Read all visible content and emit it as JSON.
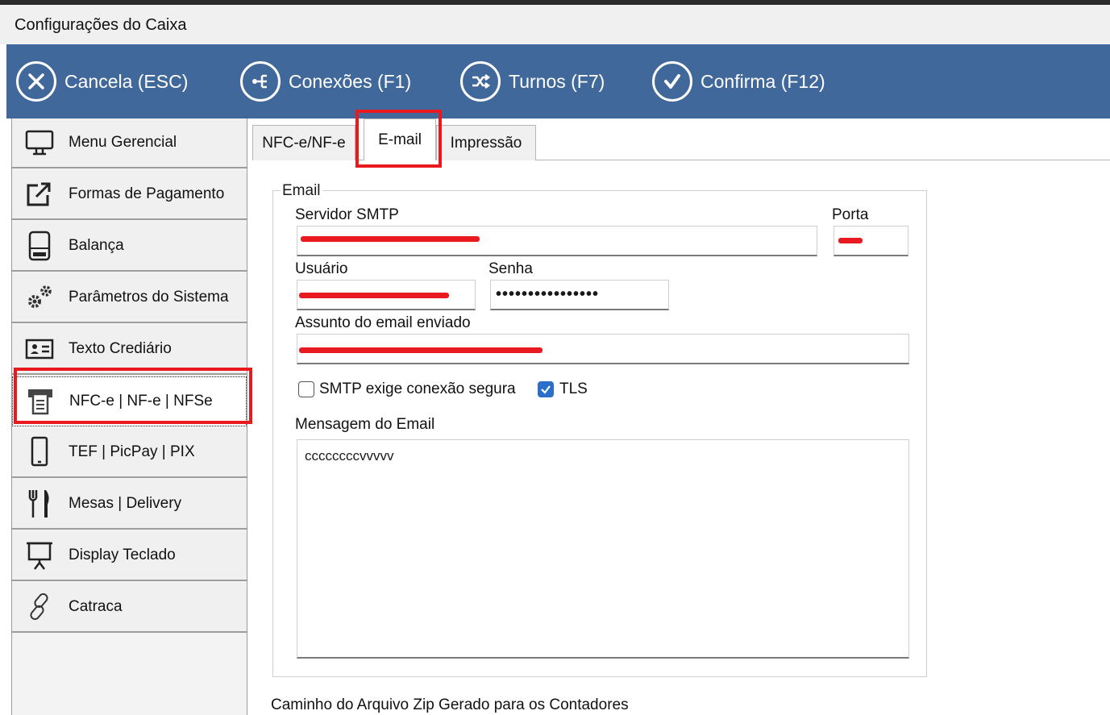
{
  "window": {
    "title": "Configurações do Caixa"
  },
  "toolbar": {
    "cancel_label": "Cancela (ESC)",
    "connections_label": "Conexões (F1)",
    "shifts_label": "Turnos (F7)",
    "confirm_label": "Confirma (F12)"
  },
  "sidebar": {
    "items": [
      {
        "label": "Menu Gerencial",
        "icon": "monitor-icon"
      },
      {
        "label": "Formas de Pagamento",
        "icon": "external-link-icon"
      },
      {
        "label": "Balança",
        "icon": "scale-icon"
      },
      {
        "label": "Parâmetros do Sistema",
        "icon": "gears-icon"
      },
      {
        "label": "Texto Crediário",
        "icon": "id-card-icon"
      },
      {
        "label": "NFC-e | NF-e | NFSe",
        "icon": "receipt-printer-icon",
        "selected": true
      },
      {
        "label": "TEF | PicPay | PIX",
        "icon": "smartphone-icon"
      },
      {
        "label": "Mesas | Delivery",
        "icon": "utensils-icon"
      },
      {
        "label": "Display Teclado",
        "icon": "presentation-board-icon"
      },
      {
        "label": "Catraca",
        "icon": "link-icon"
      }
    ]
  },
  "tabs": [
    {
      "label": "NFC-e/NF-e"
    },
    {
      "label": "E-mail",
      "active": true
    },
    {
      "label": "Impressão"
    }
  ],
  "email": {
    "group_title": "Email",
    "smtp_server_label": "Servidor SMTP",
    "port_label": "Porta",
    "user_label": "Usuário",
    "password_label": "Senha",
    "password_value": "••••••••••••••••",
    "subject_label": "Assunto do email enviado",
    "secure_smtp_label": "SMTP exige conexão segura",
    "secure_smtp_checked": false,
    "tls_label": "TLS",
    "tls_checked": true,
    "message_label": "Mensagem do Email",
    "message_value": "ccccccccvvvvv"
  },
  "zip_path_label": "Caminho do Arquivo Zip Gerado para os Contadores",
  "colors": {
    "toolbar_bg": "#41689a",
    "highlight": "#e8191f",
    "checkbox_on": "#2a6fc9"
  }
}
